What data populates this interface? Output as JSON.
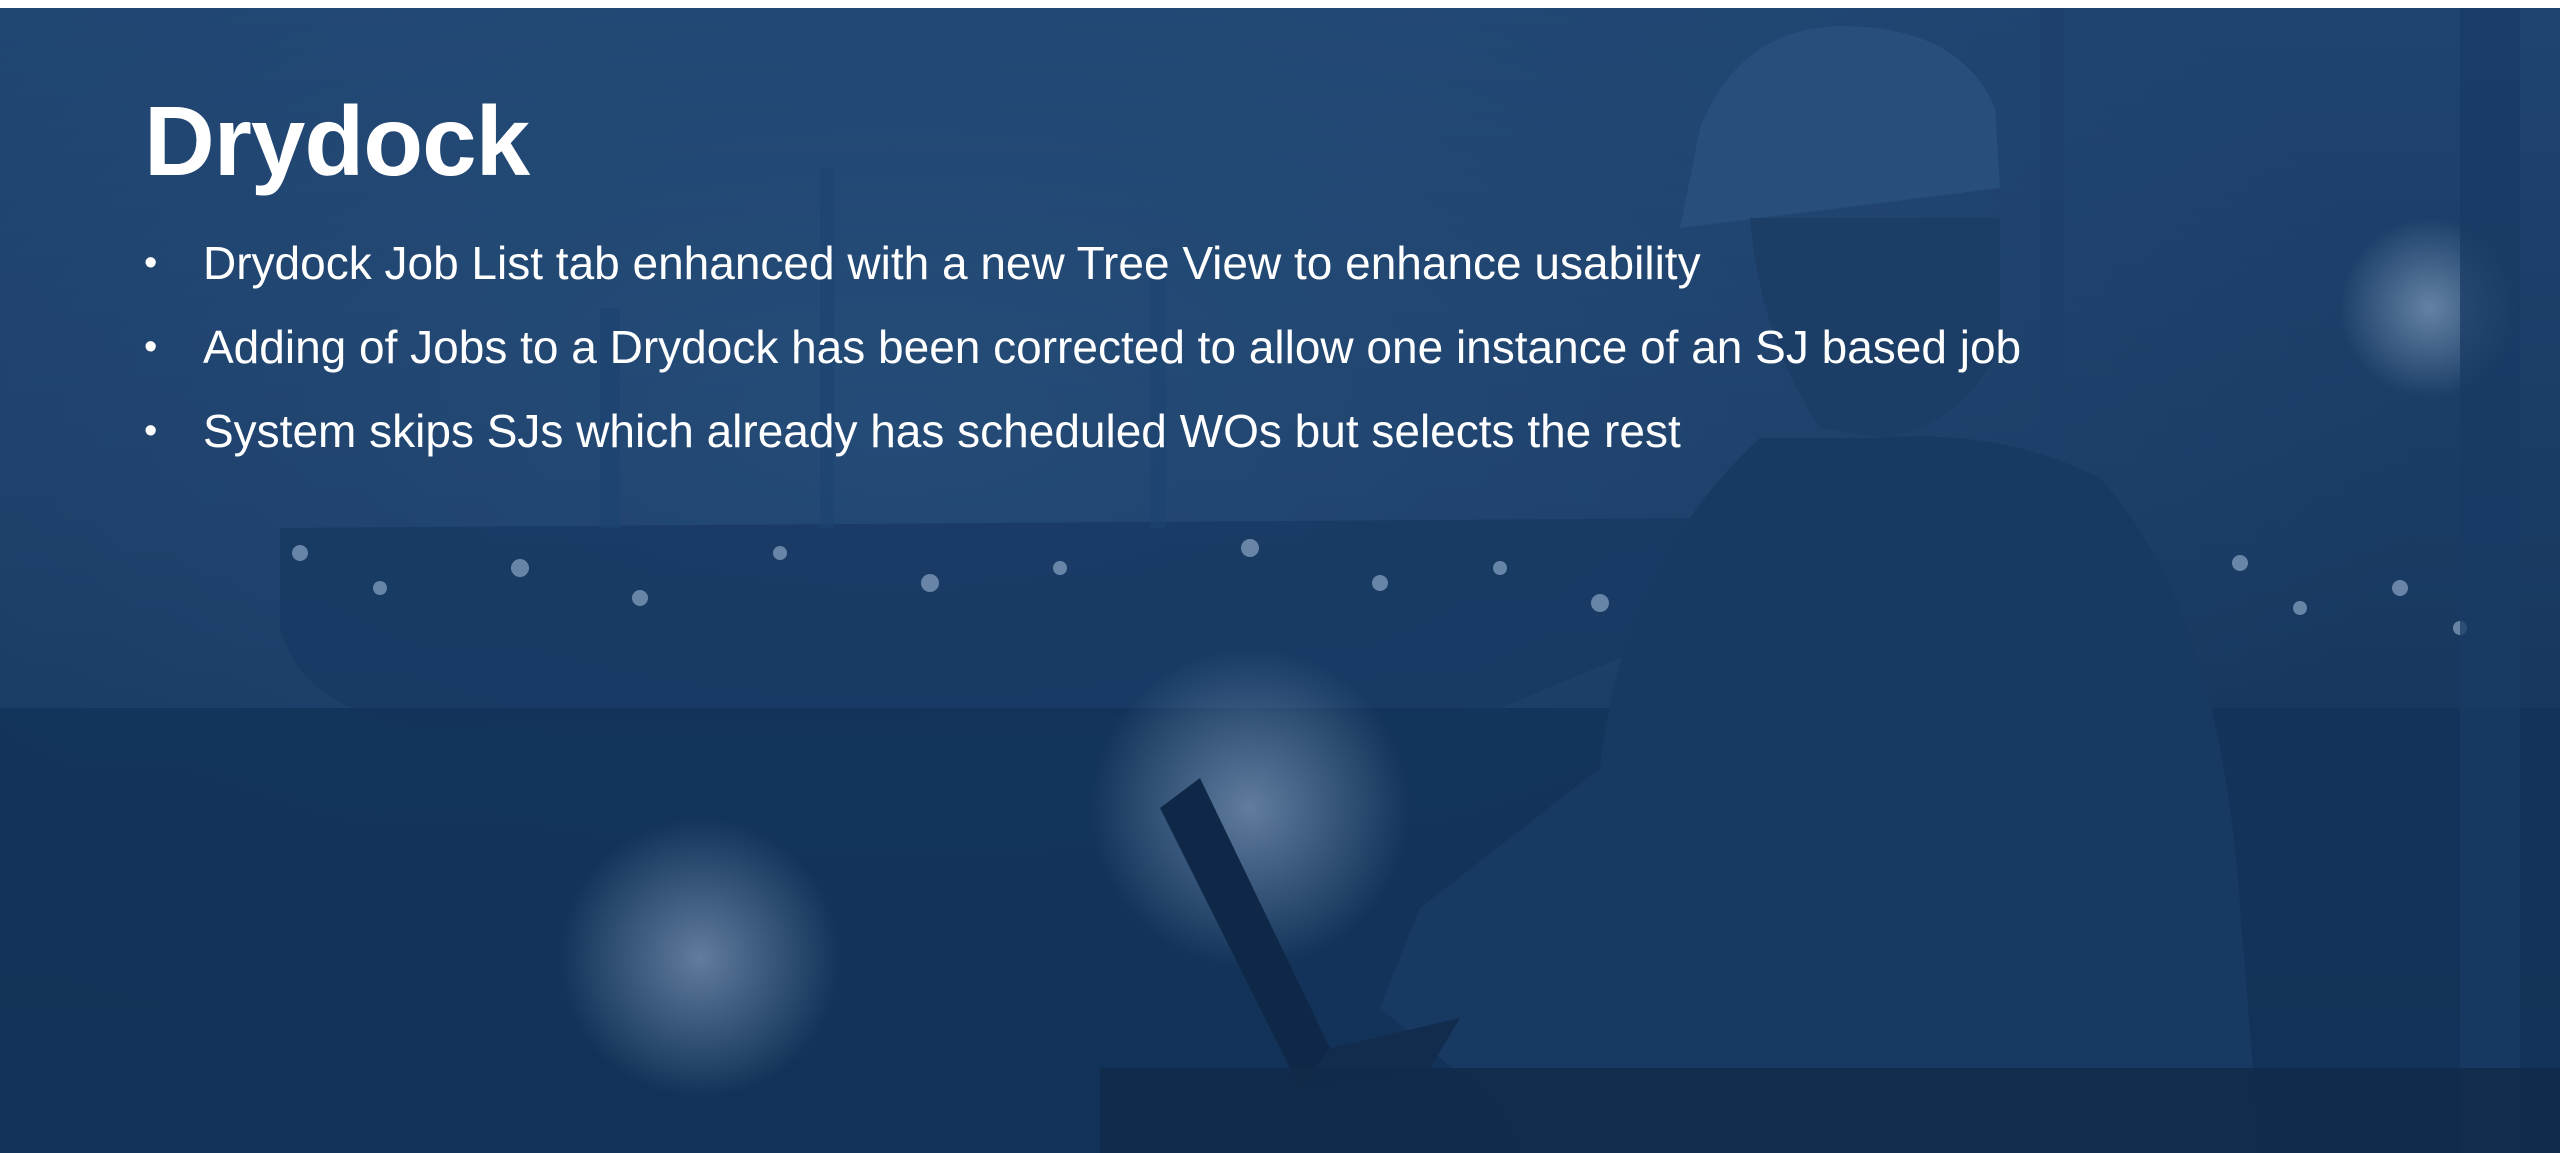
{
  "slide": {
    "title": "Drydock",
    "bullets": [
      "Drydock Job List tab enhanced with a new Tree View to enhance usability",
      "Adding of Jobs to a Drydock has been corrected to allow one instance of an SJ based job",
      "System skips SJs which already has scheduled WOs but selects the rest"
    ],
    "bullet_glyph": "•"
  },
  "colors": {
    "background": "#15365c",
    "text": "#ffffff"
  },
  "background_image": "harbor-worker-with-laptop-photo"
}
